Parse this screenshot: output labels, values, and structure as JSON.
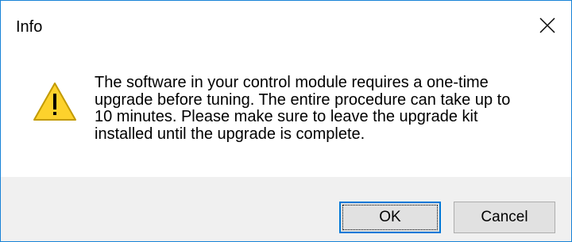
{
  "window": {
    "title": "Info",
    "close_icon": "close-icon"
  },
  "message": {
    "icon": "warning-icon",
    "lines": [
      "The software in your control module requires a one-time",
      "upgrade before tuning. The entire procedure can take up to",
      "10 minutes. Please make sure to leave the upgrade kit",
      "installed until the upgrade is complete."
    ]
  },
  "buttons": {
    "ok_label": "OK",
    "cancel_label": "Cancel"
  },
  "colors": {
    "window_border": "#1883d7",
    "footer_background": "#f0f0f0",
    "button_background": "#e1e1e1",
    "default_button_border": "#0078d7",
    "warning_fill": "#fdd22c",
    "warning_outline": "#c29a00"
  }
}
